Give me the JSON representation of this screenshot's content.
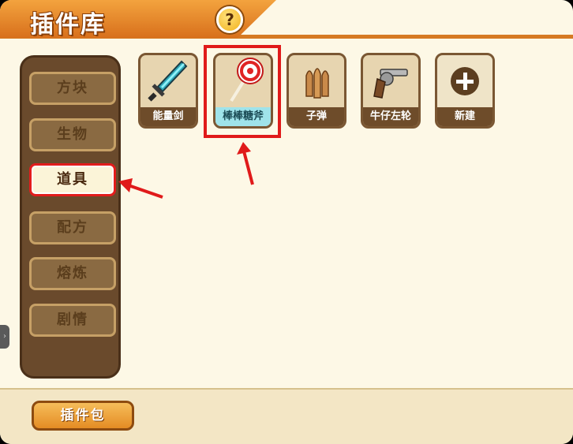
{
  "header": {
    "title": "插件库",
    "help_symbol": "?"
  },
  "sidebar": {
    "items": [
      {
        "label": "方块"
      },
      {
        "label": "生物"
      },
      {
        "label": "道具",
        "active": true
      },
      {
        "label": "配方"
      },
      {
        "label": "熔炼"
      },
      {
        "label": "剧情"
      }
    ]
  },
  "items": [
    {
      "label": "能量剑",
      "icon": "sword-icon"
    },
    {
      "label": "棒棒糖斧",
      "icon": "lollipop-icon",
      "selected": true
    },
    {
      "label": "子弹",
      "icon": "bullet-icon"
    },
    {
      "label": "牛仔左轮",
      "icon": "revolver-icon"
    },
    {
      "label": "新建",
      "icon": "plus-icon"
    }
  ],
  "footer": {
    "pack_button": "插件包"
  },
  "colors": {
    "accent": "#e48c24",
    "highlight": "#e01a1a",
    "selected_label": "#9fe3ea"
  }
}
